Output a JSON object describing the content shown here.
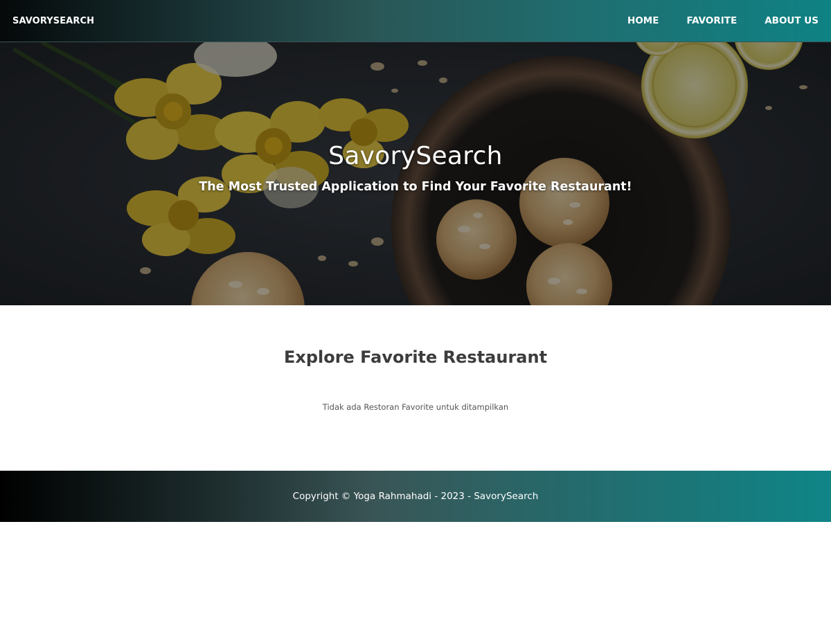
{
  "header": {
    "brand": "SAVORYSEARCH",
    "nav": [
      {
        "label": "HOME"
      },
      {
        "label": "FAVORITE"
      },
      {
        "label": "ABOUT US"
      }
    ]
  },
  "hero": {
    "title": "SavorySearch",
    "tagline": "The Most Trusted Application to Find Your Favorite Restaurant!"
  },
  "main": {
    "title": "Explore Favorite Restaurant",
    "empty_message": "Tidak ada Restoran Favorite untuk ditampilkan"
  },
  "footer": {
    "copyright": "Copyright © Yoga Rahmahadi - 2023 - SavorySearch"
  },
  "colors": {
    "header_gradient_start": "#05090a",
    "header_gradient_end": "#0f8284",
    "footer_gradient_start": "#000000",
    "footer_gradient_end": "#0f8587",
    "title_text": "#3c3c3c"
  }
}
